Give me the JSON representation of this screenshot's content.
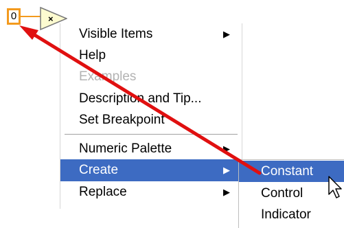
{
  "diagram": {
    "constant_value": "0",
    "node_symbol": "×",
    "colors": {
      "wire": "#f39a1e",
      "node_fill": "#fdfbd0",
      "arrow": "#e01010"
    }
  },
  "menu": {
    "items": [
      {
        "label": "Visible Items",
        "submenu": true
      },
      {
        "label": "Help"
      },
      {
        "label": "Examples",
        "disabled": true
      },
      {
        "label": "Description and Tip..."
      },
      {
        "label": "Set Breakpoint"
      },
      {
        "label": "Numeric Palette",
        "submenu": true
      },
      {
        "label": "Create",
        "submenu": true,
        "highlighted": true
      },
      {
        "label": "Replace",
        "submenu": true
      }
    ],
    "highlight_color": "#3d6bc2"
  },
  "submenu": {
    "items": [
      {
        "label": "Constant",
        "highlighted": true
      },
      {
        "label": "Control"
      },
      {
        "label": "Indicator"
      }
    ]
  },
  "icons": {
    "submenu_arrow": "▶",
    "pointer": "mouse-pointer-icon"
  }
}
